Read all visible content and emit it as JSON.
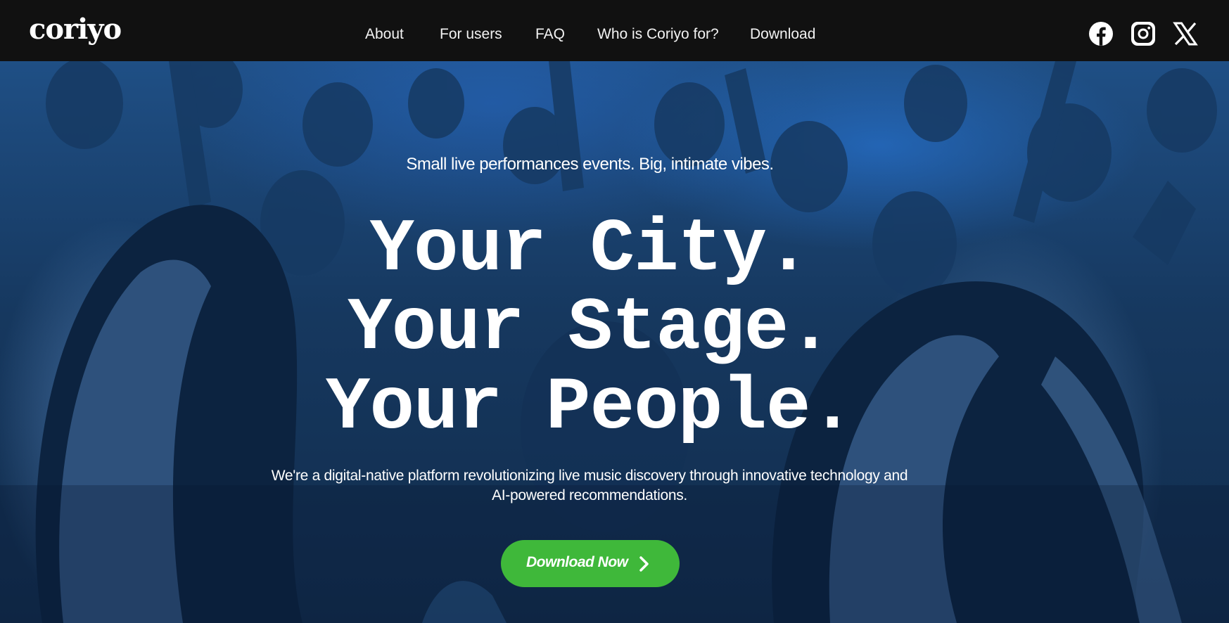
{
  "brand": {
    "logo_text": "coriyo"
  },
  "nav": {
    "links": [
      {
        "label": "About"
      },
      {
        "label": "For users"
      },
      {
        "label": "FAQ"
      },
      {
        "label": "Who is Coriyo for?"
      },
      {
        "label": "Download"
      }
    ]
  },
  "social": [
    {
      "icon": "facebook-icon"
    },
    {
      "icon": "instagram-icon"
    },
    {
      "icon": "x-icon"
    }
  ],
  "hero": {
    "tagline": "Small live performances events. Big, intimate vibes.",
    "headline": [
      "Your City.",
      "Your Stage.",
      "Your People."
    ],
    "description": "We're a digital-native platform revolutionizing live music discovery through innovative technology and AI-powered recommendations.",
    "cta_label": "Download Now",
    "cta_icon": "chevron-right-icon"
  },
  "colors": {
    "navbar_bg": "#111111",
    "hero_blue": "#1f4f85",
    "cta_green": "#3fb83a",
    "text": "#ffffff"
  }
}
